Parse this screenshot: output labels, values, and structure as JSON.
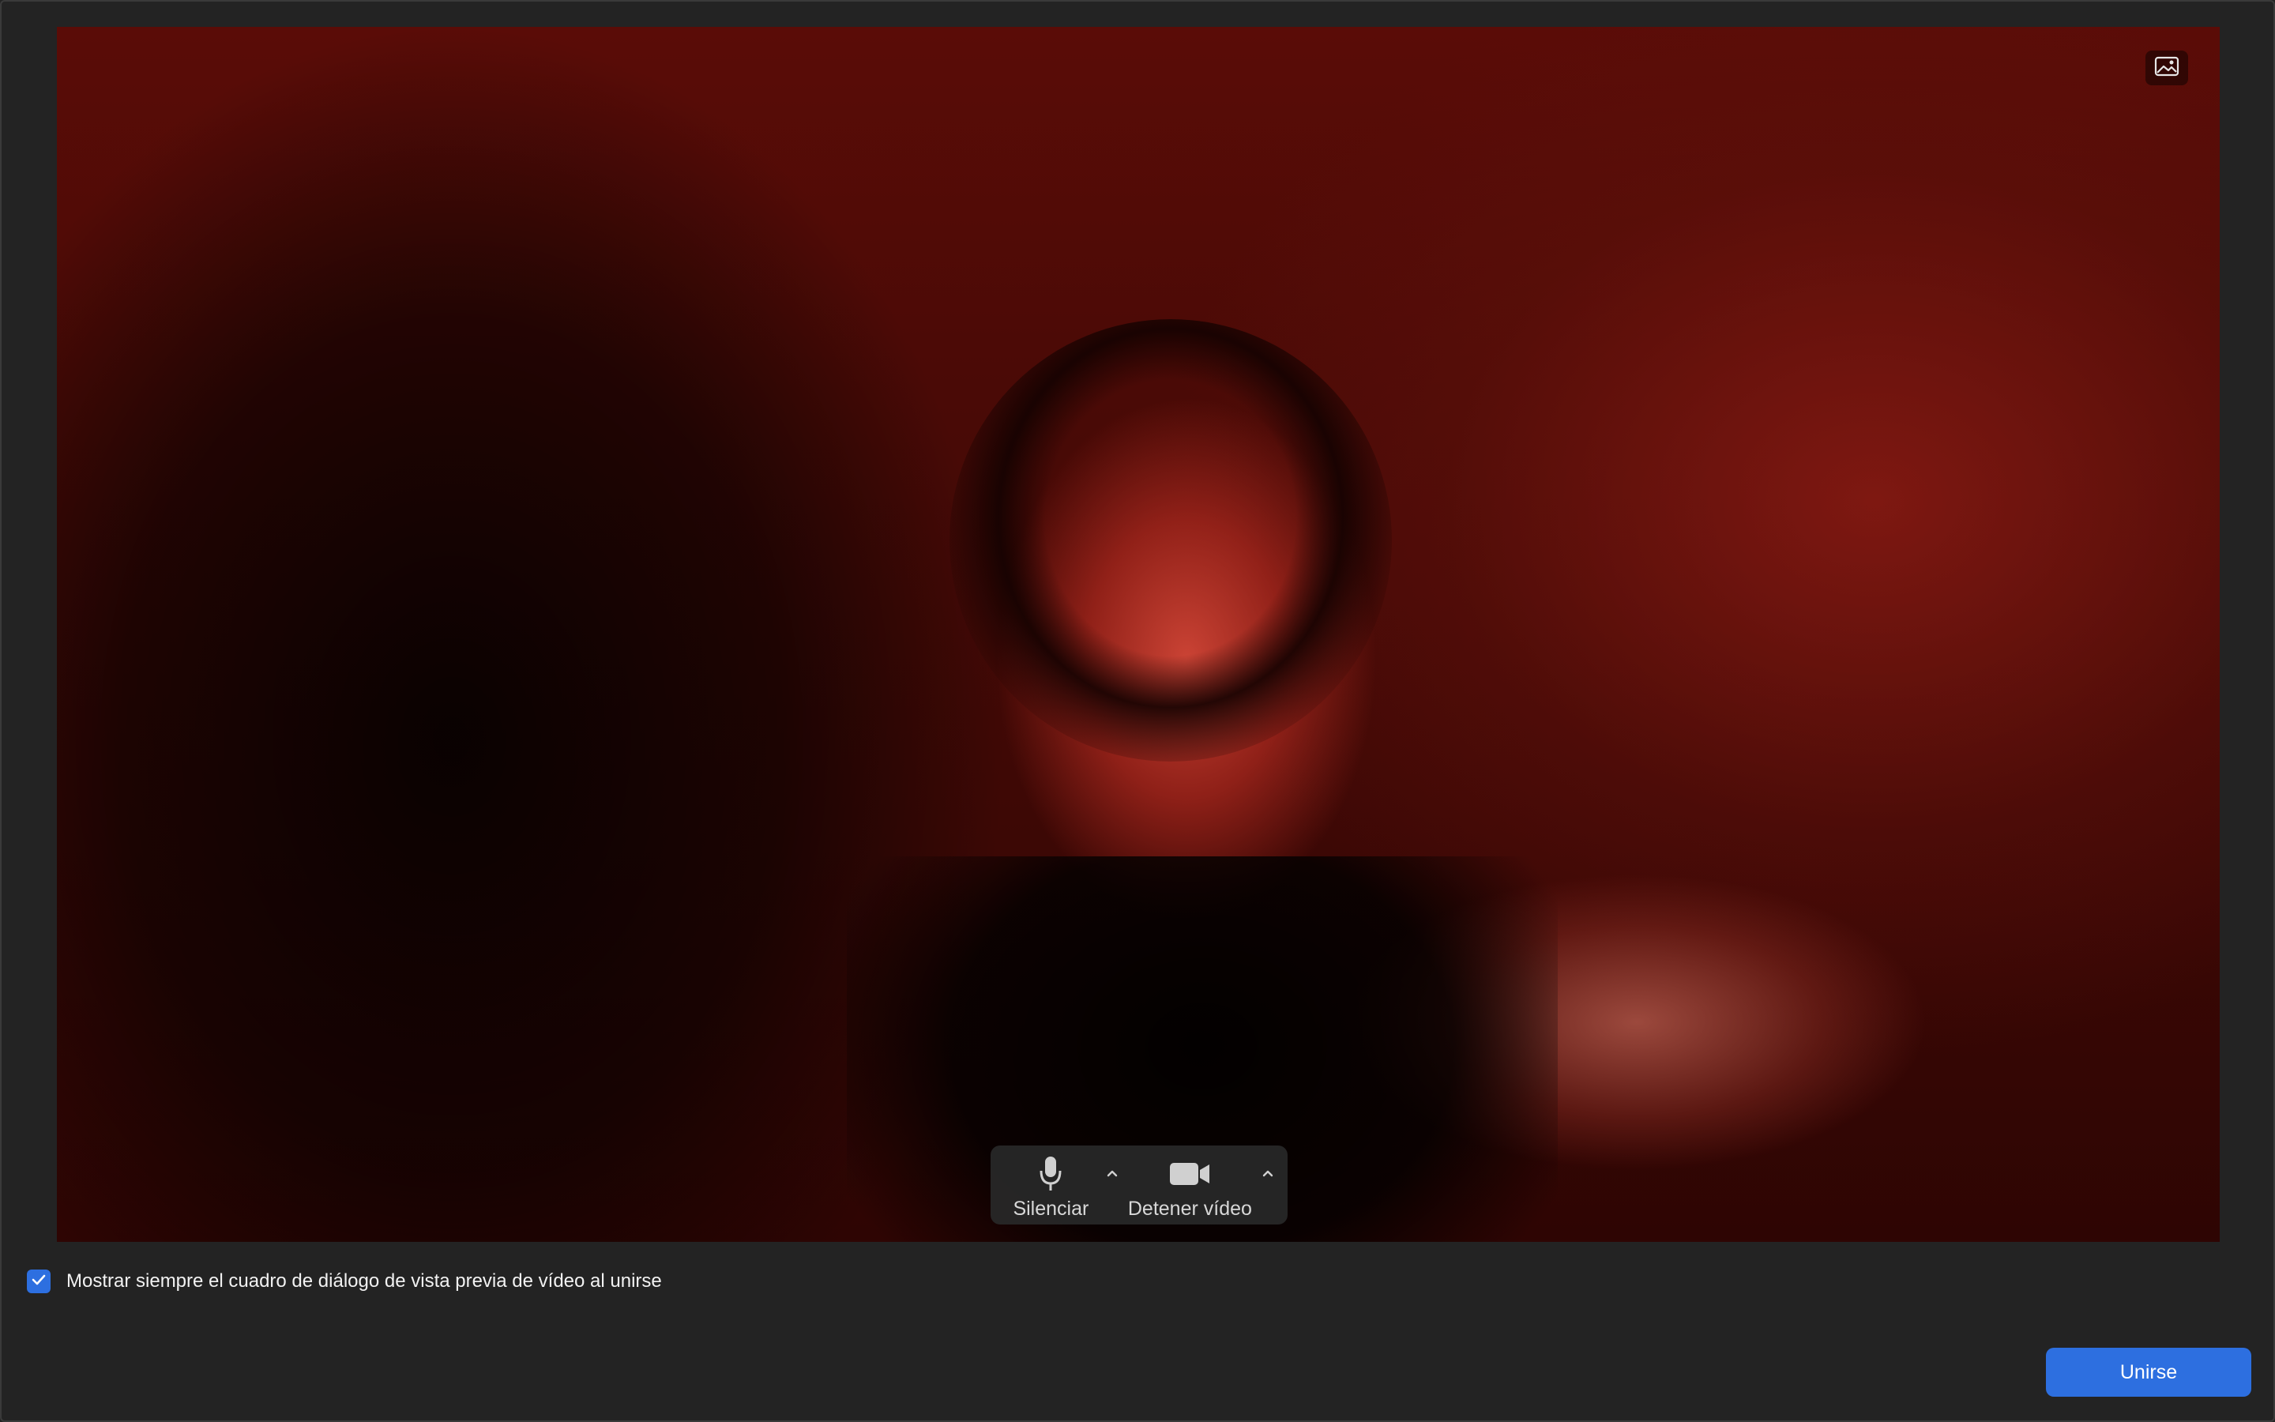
{
  "preview": {
    "background_toggle_icon": "image-icon"
  },
  "controls": {
    "mute_label": "Silenciar",
    "mute_icon": "microphone-icon",
    "video_label": "Detener vídeo",
    "video_icon": "video-camera-icon",
    "options_icon": "chevron-up-icon"
  },
  "option": {
    "always_show_preview_label": "Mostrar siempre el cuadro de diálogo de vista previa de vídeo al unirse",
    "checked": true
  },
  "join_button_label": "Unirse",
  "colors": {
    "accent": "#2d6fe0",
    "window_bg": "#232323"
  }
}
